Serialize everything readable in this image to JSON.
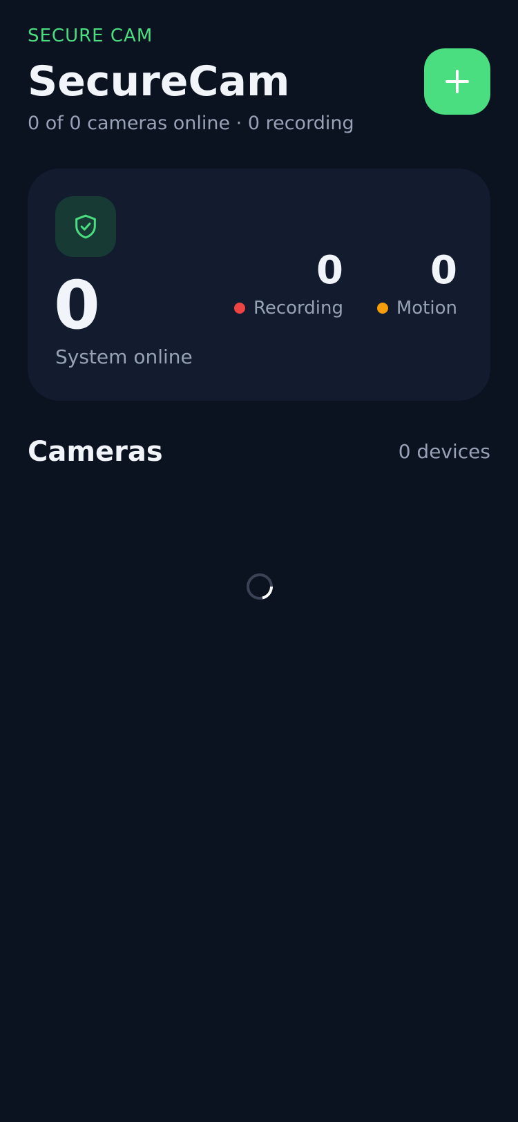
{
  "header": {
    "eyebrow": "SECURE CAM",
    "title": "SecureCam",
    "subtitle": "0 of 0 cameras online · 0 recording",
    "add_icon": "plus-icon"
  },
  "status_card": {
    "icon": "shield-check-icon",
    "online_count": "0",
    "online_label": "System online",
    "recording": {
      "value": "0",
      "label": "Recording",
      "color": "#ef4444"
    },
    "motion": {
      "value": "0",
      "label": "Motion",
      "color": "#f59e0b"
    }
  },
  "cameras": {
    "title": "Cameras",
    "count_label": "0 devices",
    "loading_icon": "loading-spinner-icon"
  },
  "colors": {
    "accent": "#4ade80",
    "background": "#0b1220",
    "card": "#121c2e"
  }
}
